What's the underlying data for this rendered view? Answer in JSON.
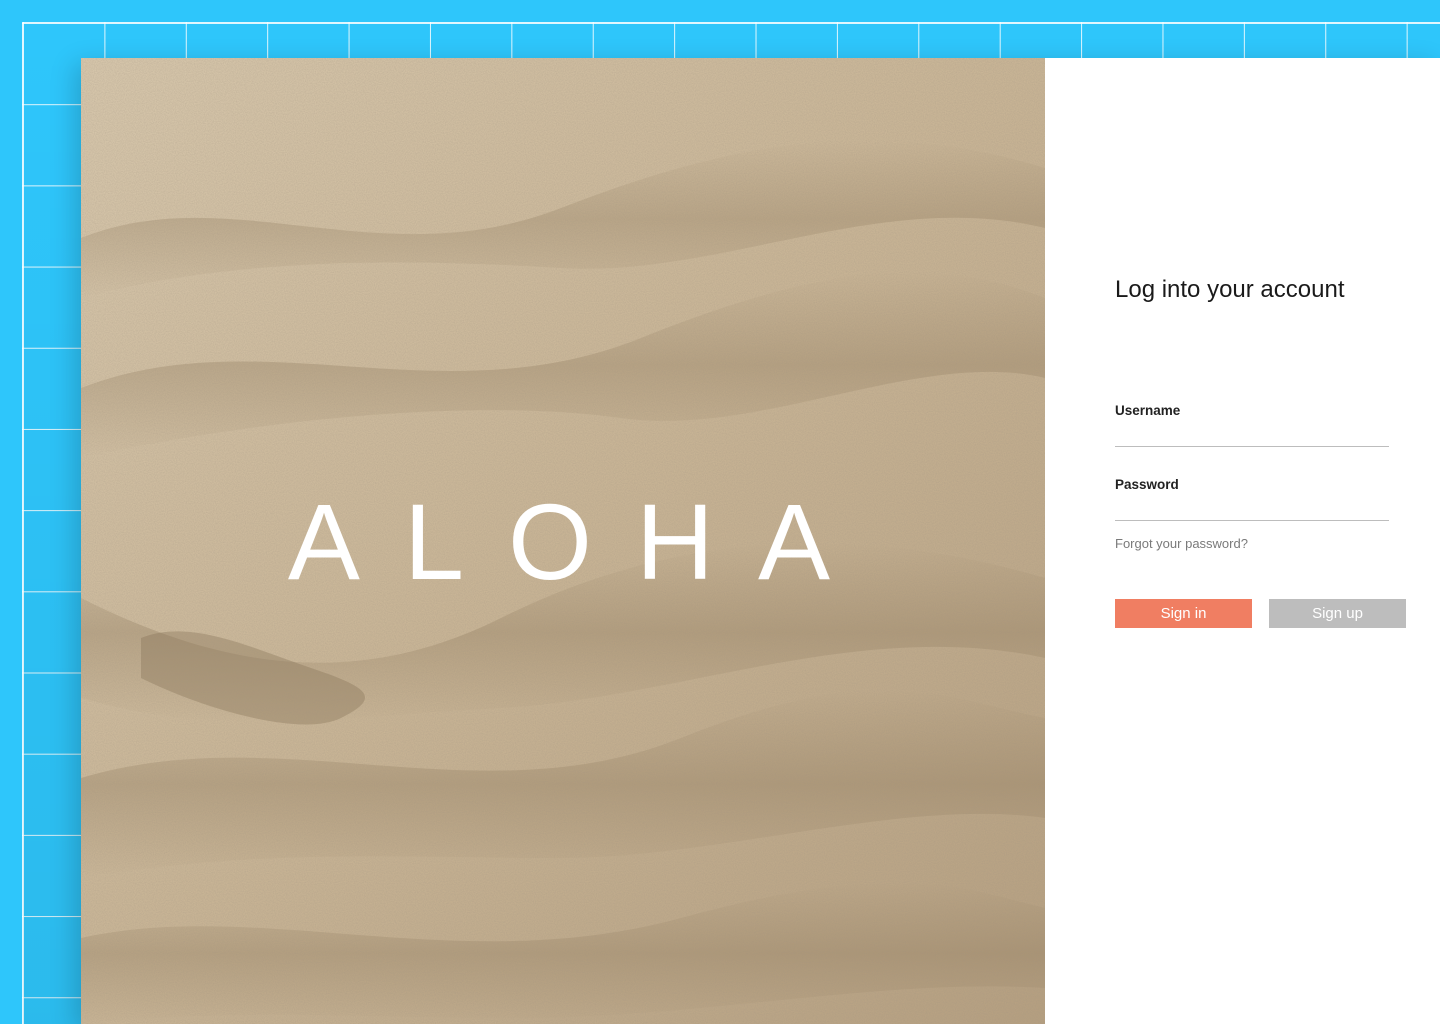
{
  "brand": {
    "logo_text": "ALOHA"
  },
  "login": {
    "title": "Log into your account",
    "username_label": "Username",
    "username_value": "",
    "password_label": "Password",
    "password_value": "",
    "forgot_link": "Forgot your password?",
    "signin_label": "Sign in",
    "signup_label": "Sign up"
  },
  "colors": {
    "background": "#2ec6fb",
    "grid_lines": "#ffffff",
    "sand": "#cbb89b",
    "panel": "#ffffff",
    "signin_button": "#f07e62",
    "signup_button": "#bdbdbd",
    "title_text": "#1a1a1a",
    "muted_text": "#7a7a7a"
  }
}
